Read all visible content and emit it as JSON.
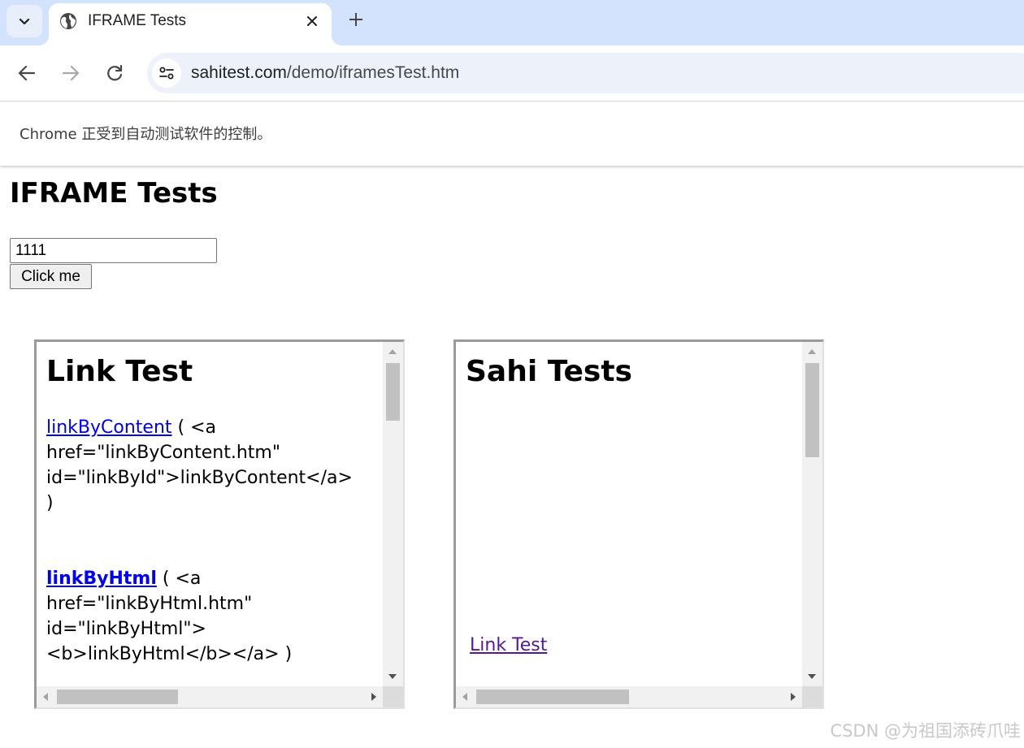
{
  "browser": {
    "tab": {
      "title": "IFRAME Tests",
      "favicon": "globe-icon"
    },
    "url_host": "sahitest.com",
    "url_path": "/demo/iframesTest.htm",
    "infobar_text": "Chrome 正受到自动测试软件的控制。",
    "colors": {
      "tabstrip": "#d3e3fd",
      "omnibox": "#edf2fa"
    }
  },
  "page": {
    "title": "IFRAME Tests",
    "input_value": "1111",
    "button_label": "Click me"
  },
  "iframe1": {
    "heading": "Link Test",
    "link1_text": "linkByContent",
    "link1_code_1": " ( <a",
    "link1_code_2": "href=\"linkByContent.htm\"",
    "link1_code_3": "id=\"linkById\">linkByContent</a>",
    "link1_code_4": ")",
    "link2_text": "linkByHtml",
    "link2_code_1": " ( <a",
    "link2_code_2": "href=\"linkByHtml.htm\"",
    "link2_code_3": "id=\"linkByHtml\">",
    "link2_code_4": "<b>linkByHtml</b></a> )"
  },
  "iframe2": {
    "heading": "Sahi Tests",
    "link_text": "Link Test"
  },
  "watermark": "CSDN @为祖国添砖爪哇"
}
